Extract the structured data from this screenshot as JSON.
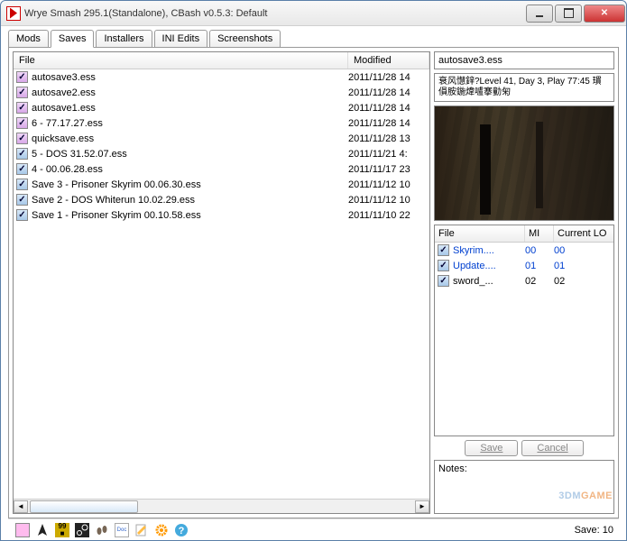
{
  "window": {
    "title": "Wrye Smash 295.1(Standalone), CBash v0.5.3: Default"
  },
  "tabs": [
    "Mods",
    "Saves",
    "Installers",
    "INI Edits",
    "Screenshots"
  ],
  "activeTab": 1,
  "columns": {
    "file": "File",
    "modified": "Modified"
  },
  "saves": [
    {
      "check": "purple",
      "name": "autosave3.ess",
      "mod": "2011/11/28 14"
    },
    {
      "check": "purple",
      "name": "autosave2.ess",
      "mod": "2011/11/28 14"
    },
    {
      "check": "purple",
      "name": "autosave1.ess",
      "mod": "2011/11/28 14"
    },
    {
      "check": "purple",
      "name": "       6 -                     77.17.27.ess",
      "mod": "2011/11/28 14"
    },
    {
      "check": "purple",
      "name": "quicksave.ess",
      "mod": "2011/11/28 13"
    },
    {
      "check": "blue",
      "name": "       5 - DOS             31.52.07.ess",
      "mod": "2011/11/21 4:"
    },
    {
      "check": "blue",
      "name": "       4 -                     00.06.28.ess",
      "mod": "2011/11/17 23"
    },
    {
      "check": "blue",
      "name": "Save 3 - Prisoner  Skyrim  00.06.30.ess",
      "mod": "2011/11/12 10"
    },
    {
      "check": "blue",
      "name": "Save 2 - DOS  Whiterun  10.02.29.ess",
      "mod": "2011/11/12 10"
    },
    {
      "check": "blue",
      "name": "Save 1 - Prisoner  Skyrim  00.10.58.ess",
      "mod": "2011/11/10 22"
    }
  ],
  "detail": {
    "title": "autosave3.ess",
    "desc": "衰风懳鋅?Level 41, Day 3, Play 77:45 瑻傊胺鍦煒嚧搴勭匊"
  },
  "masters": {
    "cols": {
      "file": "File",
      "mi": "MI",
      "lo": "Current LO"
    },
    "rows": [
      {
        "check": "blue",
        "name": "Skyrim....",
        "mi": "00",
        "lo": "00",
        "blue": true
      },
      {
        "check": "blue",
        "name": "Update....",
        "mi": "01",
        "lo": "01",
        "blue": true
      },
      {
        "check": "blue",
        "name": "sword_...",
        "mi": "02",
        "lo": "02",
        "blue": false
      }
    ]
  },
  "buttons": {
    "save": "Save",
    "cancel": "Cancel"
  },
  "notesLabel": "Notes:",
  "status": "Save: 10",
  "watermark": {
    "a": "3DM",
    "b": "GAME"
  }
}
